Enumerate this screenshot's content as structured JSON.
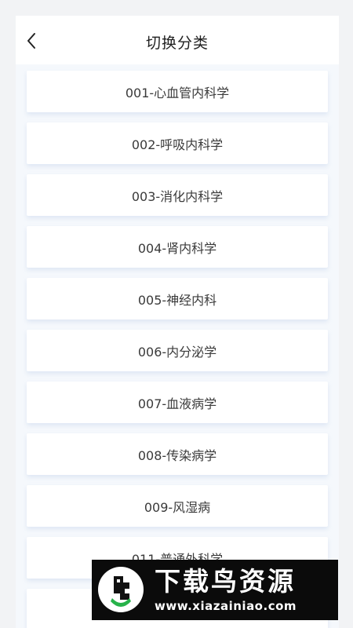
{
  "header": {
    "title": "切换分类"
  },
  "categories": [
    "001-心血管内科学",
    "002-呼吸内科学",
    "003-消化内科学",
    "004-肾内科学",
    "005-神经内科",
    "006-内分泌学",
    "007-血液病学",
    "008-传染病学",
    "009-风湿病",
    "011-普通外科学"
  ],
  "watermark": {
    "name": "下载鸟资源",
    "url": "www.xiazainiao.com"
  },
  "colors": {
    "background": "#f5f8fc",
    "card": "#ffffff",
    "text": "#3a3a3a",
    "watermark_bg": "#0b0b0b",
    "watermark_accent": "#27b24a"
  }
}
